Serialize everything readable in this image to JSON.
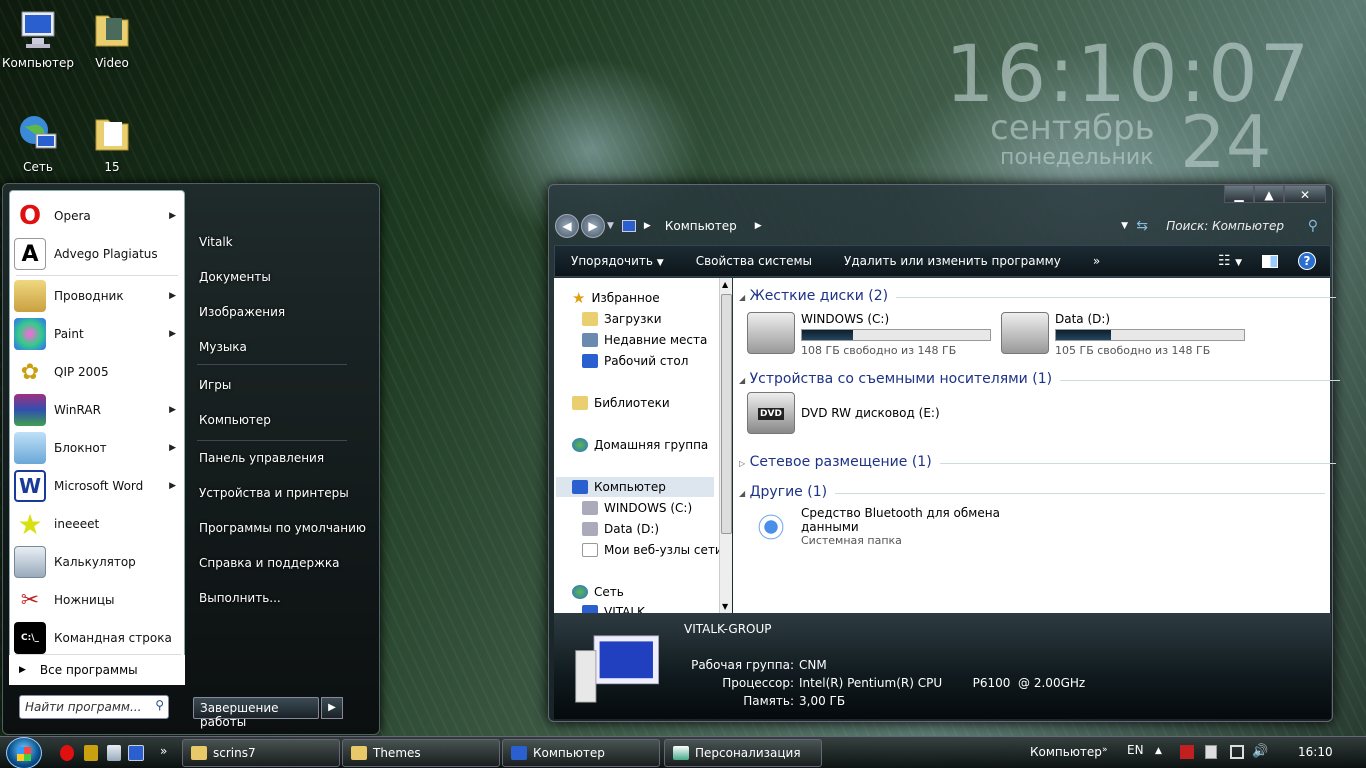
{
  "desktop": {
    "icons": [
      {
        "label": "Компьютер"
      },
      {
        "label": "Video"
      },
      {
        "label": "Сеть"
      },
      {
        "label": "15"
      }
    ]
  },
  "clock": {
    "time": "16:10:07",
    "month": "сентябрь",
    "day": "понедельник",
    "date": "24"
  },
  "start_menu": {
    "programs": [
      {
        "label": "Opera",
        "arrow": "▶"
      },
      {
        "label": "Advego Plagiatus",
        "arrow": ""
      },
      {
        "label": "Проводник",
        "arrow": "▶"
      },
      {
        "label": "Paint",
        "arrow": "▶"
      },
      {
        "label": "QIP 2005",
        "arrow": ""
      },
      {
        "label": "WinRAR",
        "arrow": "▶"
      },
      {
        "label": "Блокнот",
        "arrow": "▶"
      },
      {
        "label": "Microsoft Word",
        "arrow": "▶"
      },
      {
        "label": "ineeeet",
        "arrow": ""
      },
      {
        "label": "Калькулятор",
        "arrow": ""
      },
      {
        "label": "Ножницы",
        "arrow": ""
      },
      {
        "label": "Командная строка",
        "arrow": ""
      }
    ],
    "all_programs": "Все программы",
    "search_placeholder": "Найти программ...",
    "right": [
      {
        "label": "Vitalk"
      },
      {
        "label": "Документы"
      },
      {
        "label": "Изображения"
      },
      {
        "label": "Музыка"
      },
      {
        "label": "Игры"
      },
      {
        "label": "Компьютер"
      },
      {
        "label": "Панель управления"
      },
      {
        "label": "Устройства и принтеры"
      },
      {
        "label": "Программы по умолчанию"
      },
      {
        "label": "Справка и поддержка"
      },
      {
        "label": "Выполнить..."
      }
    ],
    "shutdown": "Завершение работы"
  },
  "explorer": {
    "breadcrumb": "Компьютер",
    "search_placeholder": "Поиск: Компьютер",
    "toolbar": {
      "organize": "Упорядочить",
      "system_props": "Свойства системы",
      "uninstall": "Удалить или изменить программу",
      "more": "»"
    },
    "nav": [
      {
        "label": "Избранное"
      },
      {
        "label": "Загрузки"
      },
      {
        "label": "Недавние места"
      },
      {
        "label": "Рабочий стол"
      },
      {
        "label": "Библиотеки"
      },
      {
        "label": "Домашняя группа"
      },
      {
        "label": "Компьютер"
      },
      {
        "label": "WINDOWS (C:)"
      },
      {
        "label": "Data (D:)"
      },
      {
        "label": "Мои веб-узлы сети"
      },
      {
        "label": "Сеть"
      },
      {
        "label": "VITALK"
      }
    ],
    "groups": {
      "hdd": "Жесткие диски (2)",
      "removable": "Устройства со съемными носителями (1)",
      "network": "Сетевое размещение (1)",
      "other": "Другие (1)"
    },
    "drives": [
      {
        "name": "WINDOWS (C:)",
        "free": "108 ГБ свободно из 148 ГБ",
        "used_fraction": 0.27
      },
      {
        "name": "Data (D:)",
        "free": "105 ГБ свободно из 148 ГБ",
        "used_fraction": 0.29
      }
    ],
    "dvd": "DVD RW дисковод (E:)",
    "bluetooth": {
      "name1": "Средство Bluetooth для обмена",
      "name2": "данными",
      "type": "Системная папка"
    },
    "details": {
      "name": "VITALK-GROUP",
      "wg_label": "Рабочая группа:",
      "wg": "CNM",
      "cpu_label": "Процессор:",
      "cpu": "Intel(R) Pentium(R) CPU        P6100  @ 2.00GHz",
      "mem_label": "Память:",
      "mem": "3,00 ГБ"
    }
  },
  "taskbar": {
    "buttons": [
      {
        "label": "scrins7"
      },
      {
        "label": "Themes"
      },
      {
        "label": "Компьютер"
      },
      {
        "label": "Персонализация"
      }
    ],
    "computer": "Компьютер",
    "lang": "EN",
    "time": "16:10"
  }
}
